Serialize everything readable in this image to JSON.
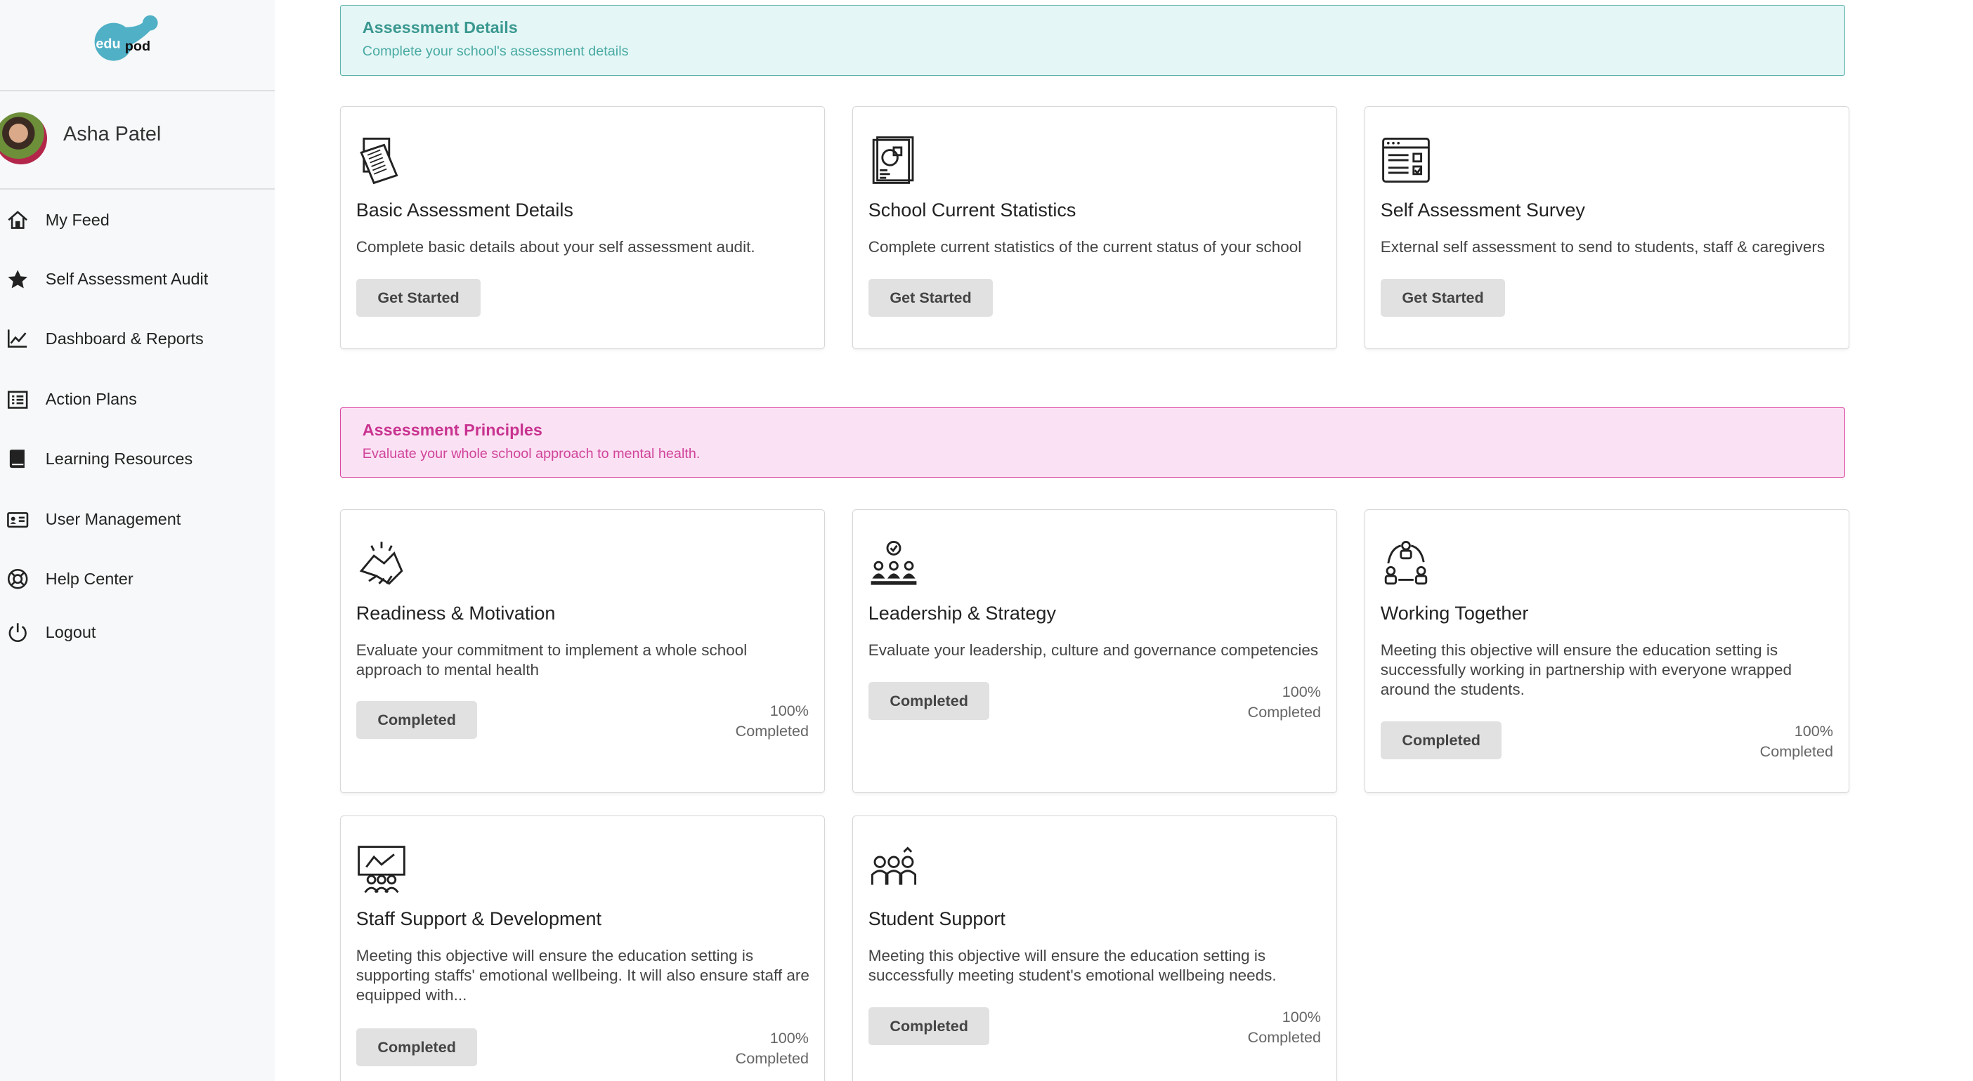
{
  "sidebar": {
    "logo": "edupod",
    "user_name": "Asha Patel",
    "nav": [
      {
        "label": "My Feed",
        "icon": "home-icon"
      },
      {
        "label": "Self Assessment Audit",
        "icon": "star-icon"
      },
      {
        "label": "Dashboard & Reports",
        "icon": "chart-line-icon"
      },
      {
        "label": "Action Plans",
        "icon": "list-icon"
      },
      {
        "label": "Learning Resources",
        "icon": "book-icon"
      },
      {
        "label": "User Management",
        "icon": "id-card-icon"
      },
      {
        "label": "Help Center",
        "icon": "life-ring-icon"
      },
      {
        "label": "Logout",
        "icon": "power-icon"
      }
    ]
  },
  "details_banner": {
    "title": "Assessment Details",
    "subtitle": "Complete your school's assessment details"
  },
  "details_cards": [
    {
      "title": "Basic Assessment Details",
      "desc": "Complete basic details about your self assessment audit.",
      "button": "Get Started",
      "icon": "documents-icon"
    },
    {
      "title": "School Current Statistics",
      "desc": "Complete current statistics of the current status of your school",
      "button": "Get Started",
      "icon": "statistics-report-icon"
    },
    {
      "title": "Self Assessment Survey",
      "desc": "External self assessment to send to students, staff & caregivers",
      "button": "Get Started",
      "icon": "survey-form-icon"
    }
  ],
  "principles_banner": {
    "title": "Assessment Principles",
    "subtitle": "Evaluate your whole school approach to mental health."
  },
  "principle_cards": [
    {
      "title": "Readiness & Motivation",
      "desc": "Evaluate your commitment to implement a whole school approach to mental health",
      "button": "Completed",
      "percent": "100%",
      "percent_label": "Completed",
      "icon": "handshake-icon"
    },
    {
      "title": "Leadership & Strategy",
      "desc": "Evaluate your leadership, culture and governance competencies",
      "button": "Completed",
      "percent": "100%",
      "percent_label": "Completed",
      "icon": "leadership-icon"
    },
    {
      "title": "Working Together",
      "desc": "Meeting this objective will ensure the education setting is successfully working in partnership with everyone wrapped around the students.",
      "button": "Completed",
      "percent": "100%",
      "percent_label": "Completed",
      "icon": "teamwork-cycle-icon"
    },
    {
      "title": "Staff Support & Development",
      "desc": "Meeting this objective will ensure the education setting is supporting staffs' emotional wellbeing. It will also ensure staff are equipped with...",
      "button": "Completed",
      "percent": "100%",
      "percent_label": "Completed",
      "icon": "staff-training-icon"
    },
    {
      "title": "Student Support",
      "desc": "Meeting this objective will ensure the education setting is successfully meeting student's emotional wellbeing needs.",
      "button": "Completed",
      "percent": "100%",
      "percent_label": "Completed",
      "icon": "students-icon"
    }
  ]
}
